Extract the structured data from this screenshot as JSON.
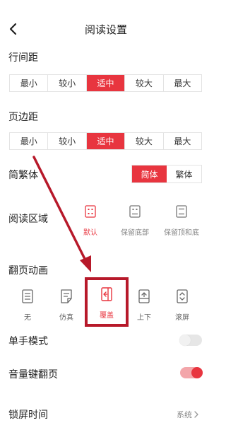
{
  "header": {
    "title": "阅读设置",
    "back_icon": "chevron-left-icon"
  },
  "line_spacing": {
    "label": "行间距",
    "options": [
      "最小",
      "较小",
      "适中",
      "较大",
      "最大"
    ],
    "selected": "适中"
  },
  "page_margin": {
    "label": "页边距",
    "options": [
      "最小",
      "较小",
      "适中",
      "较大",
      "最大"
    ],
    "selected": "适中"
  },
  "script": {
    "label": "简繁体",
    "options": [
      "简体",
      "繁体"
    ],
    "selected": "简体"
  },
  "reading_area": {
    "label": "阅读区域",
    "options": [
      {
        "label": "默认",
        "icon": "reading-area-default-icon"
      },
      {
        "label": "保留底部",
        "icon": "reading-area-keep-bottom-icon"
      },
      {
        "label": "保留顶和底",
        "icon": "reading-area-keep-top-bottom-icon"
      }
    ],
    "selected": "默认"
  },
  "page_turn": {
    "label": "翻页动画",
    "options": [
      {
        "label": "无",
        "icon": "no-animation-icon"
      },
      {
        "label": "仿真",
        "icon": "simulation-icon"
      },
      {
        "label": "覆盖",
        "icon": "cover-icon"
      },
      {
        "label": "上下",
        "icon": "up-down-icon"
      },
      {
        "label": "滚屏",
        "icon": "scroll-icon"
      }
    ],
    "selected": "覆盖"
  },
  "one_hand_mode": {
    "label": "单手模式",
    "enabled": false
  },
  "volume_key_turn": {
    "label": "音量键翻页",
    "enabled": true
  },
  "lock_screen_time": {
    "label": "锁屏时间",
    "value": "系统",
    "chevron": "chevron-right-icon"
  },
  "colors": {
    "accent": "#e8353f",
    "annotation": "#b7192a"
  }
}
